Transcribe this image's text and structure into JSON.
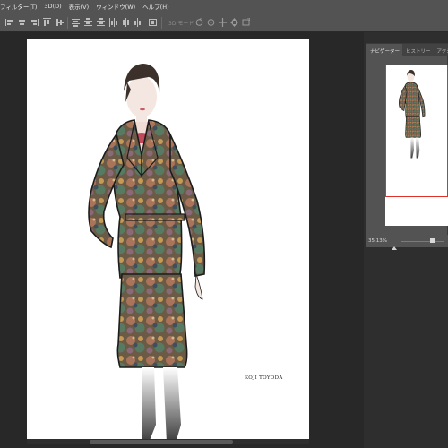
{
  "menu": {
    "items": [
      {
        "label": "フィルター(T)"
      },
      {
        "label": "3D(D)"
      },
      {
        "label": "表示(V)"
      },
      {
        "label": "ウィンドウ(W)"
      },
      {
        "label": "ヘルプ(H)"
      }
    ]
  },
  "options_bar": {
    "mode_label": "3D モード :"
  },
  "canvas": {
    "signature": "KOJI TOYODA"
  },
  "navigator": {
    "tabs": [
      {
        "label": "ナビゲーター"
      },
      {
        "label": "ヒストリー"
      },
      {
        "label": "アクション"
      }
    ],
    "zoom_label": "35.13%",
    "zoom_fraction": 0.75,
    "view_rect_color": "#e0302a"
  },
  "colors": {
    "chrome": "#535353",
    "workspace": "#282828",
    "accent": "#e0302a"
  }
}
